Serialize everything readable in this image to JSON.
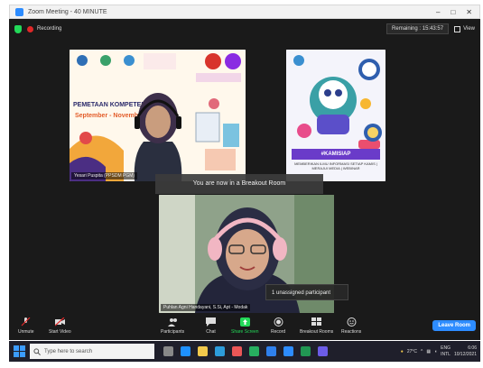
{
  "window": {
    "title": "Zoom Meeting - 40 MINUTE"
  },
  "topbar": {
    "recording": "Recording",
    "remaining": "Remaining : 15:43:57",
    "view": "View"
  },
  "tiles": [
    {
      "name": "Yesari Puspita (PPSDM PGM)",
      "slide_title": "PEMETAAN KOMPETENSI ... PFM",
      "slide_subtitle": "September - November"
    },
    {
      "poster_banner": "#KAMISIAP",
      "poster_sub": "MEMBERIKAN ILMU INFORMASI SETIAP KAMIS | MERAJUI MEDIA | WEBINAR"
    },
    {
      "name": "Puhlan Agni Handayani, S.Si, Apt - Modak"
    }
  ],
  "breakout_banner": "You are now in a Breakout Room",
  "unassigned": "1 unassigned participant",
  "controls": {
    "unmute": "Unmute",
    "start_video": "Start Video",
    "participants": "Participants",
    "participants_count": "6",
    "chat": "Chat",
    "share_screen": "Share Screen",
    "record": "Record",
    "breakout_rooms": "Breakout Rooms",
    "reactions": "Reactions",
    "leave_room": "Leave Room"
  },
  "taskbar": {
    "search_placeholder": "Type here to search",
    "temperature": "27°C",
    "lang": "ENG",
    "lang2": "INTL",
    "time": "6:06",
    "date": "10/12/2021"
  },
  "colors": {
    "zoom_blue": "#2d8cff",
    "record_red": "#e02828",
    "shield_green": "#23d959",
    "poster_purple": "#6a3bc9"
  }
}
